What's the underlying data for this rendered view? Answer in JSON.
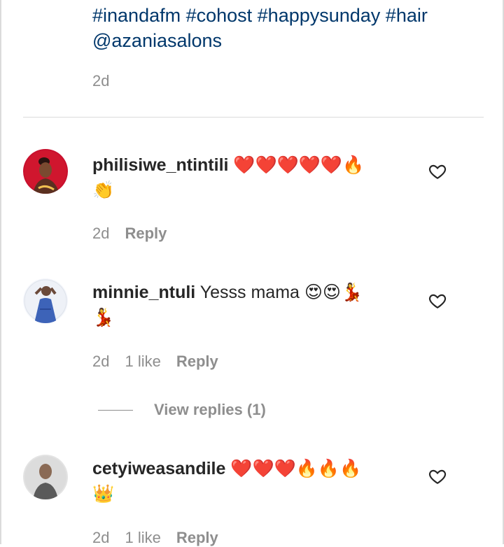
{
  "caption": {
    "tags": "#inandafm #cohost #happysunday #hair",
    "mention": "@azaniasalons",
    "time": "2d"
  },
  "comments": [
    {
      "username": "philisiwe_ntintili",
      "text": "",
      "emoji_line1": "❤️❤️❤️❤️❤️🔥",
      "emoji_line2": "👏",
      "time": "2d",
      "likes": "",
      "reply": "Reply"
    },
    {
      "username": "minnie_ntuli",
      "text": "Yesss mama",
      "emoji_line1": "😍😍💃",
      "emoji_line2": "💃",
      "time": "2d",
      "likes": "1 like",
      "reply": "Reply",
      "view_replies": "View replies (1)"
    },
    {
      "username": "cetyiweasandile",
      "text": "",
      "emoji_line1": "❤️❤️❤️🔥🔥🔥",
      "emoji_line2": "👑",
      "time": "2d",
      "likes": "1 like",
      "reply": "Reply"
    }
  ],
  "icons": {
    "like": "heart-outline-icon"
  },
  "colors": {
    "link": "#00376b",
    "muted": "#8e8e8e",
    "text": "#262626",
    "divider": "#dbdbdb"
  }
}
